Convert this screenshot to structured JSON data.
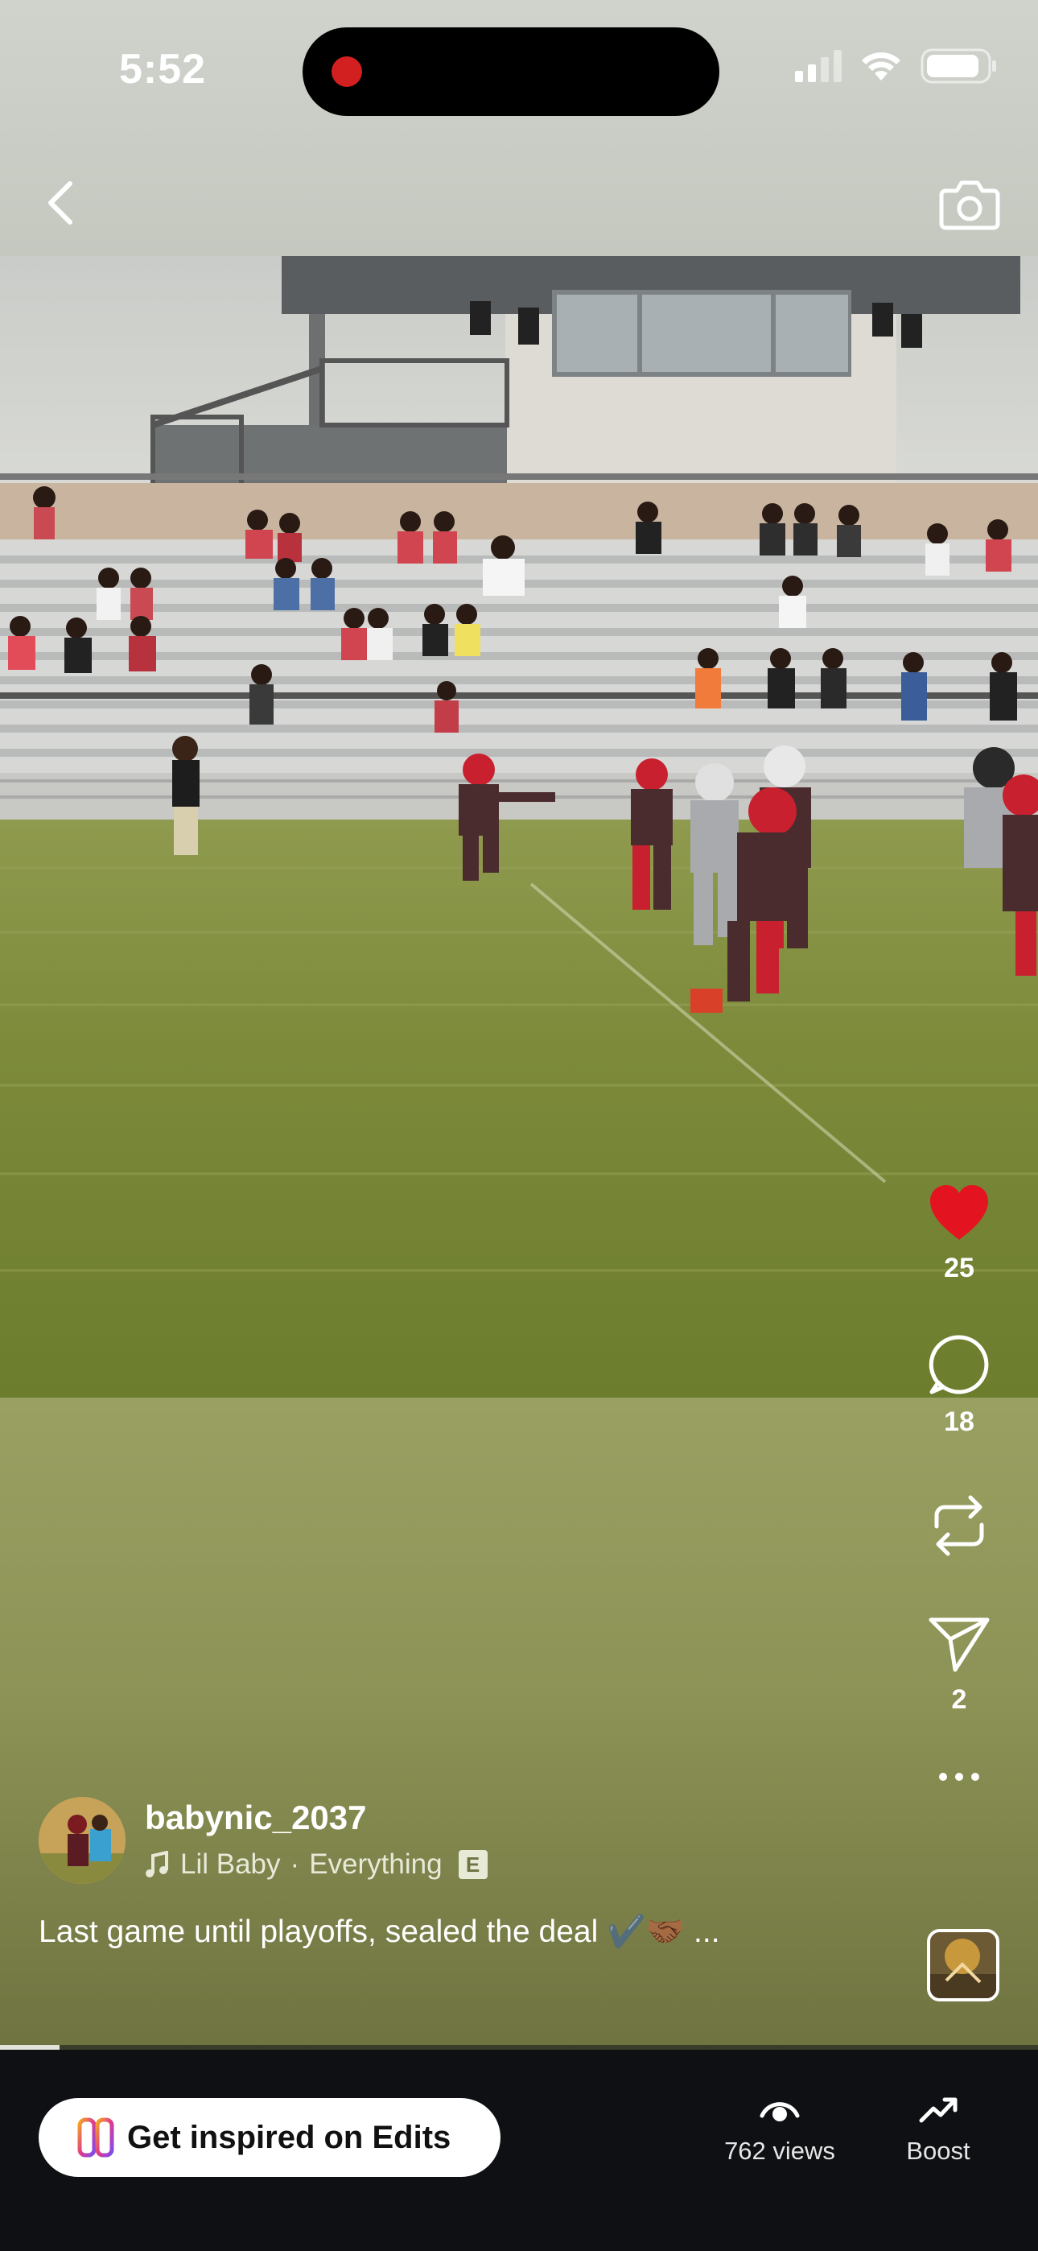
{
  "status_bar": {
    "time": "5:52",
    "recording_color": "#d21f1f"
  },
  "header": {
    "back_icon": "chevron-left-icon",
    "camera_icon": "camera-icon"
  },
  "actions": {
    "like": {
      "icon": "heart-icon",
      "count": "25",
      "color": "#e3141f",
      "liked": true
    },
    "comment": {
      "icon": "comment-icon",
      "count": "18"
    },
    "repost": {
      "icon": "repost-icon",
      "count": ""
    },
    "share": {
      "icon": "send-icon",
      "count": "2"
    },
    "more": {
      "icon": "more-horizontal-icon"
    }
  },
  "post": {
    "username": "babynic_2037",
    "music_artist": "Lil Baby",
    "music_separator": "·",
    "music_title": "Everything",
    "explicit_badge": "E",
    "caption": "Last game until playoffs, sealed the deal ✔️🤝🏾 ..."
  },
  "playback": {
    "progress": 0.057
  },
  "bottom_bar": {
    "edits_label": "Get inspired on Edits",
    "views_label": "762 views",
    "boost_label": "Boost"
  },
  "colors": {
    "accent_like": "#e3141f",
    "bottom_bar": "#0e1013",
    "video_bottom": "#8d9356"
  }
}
